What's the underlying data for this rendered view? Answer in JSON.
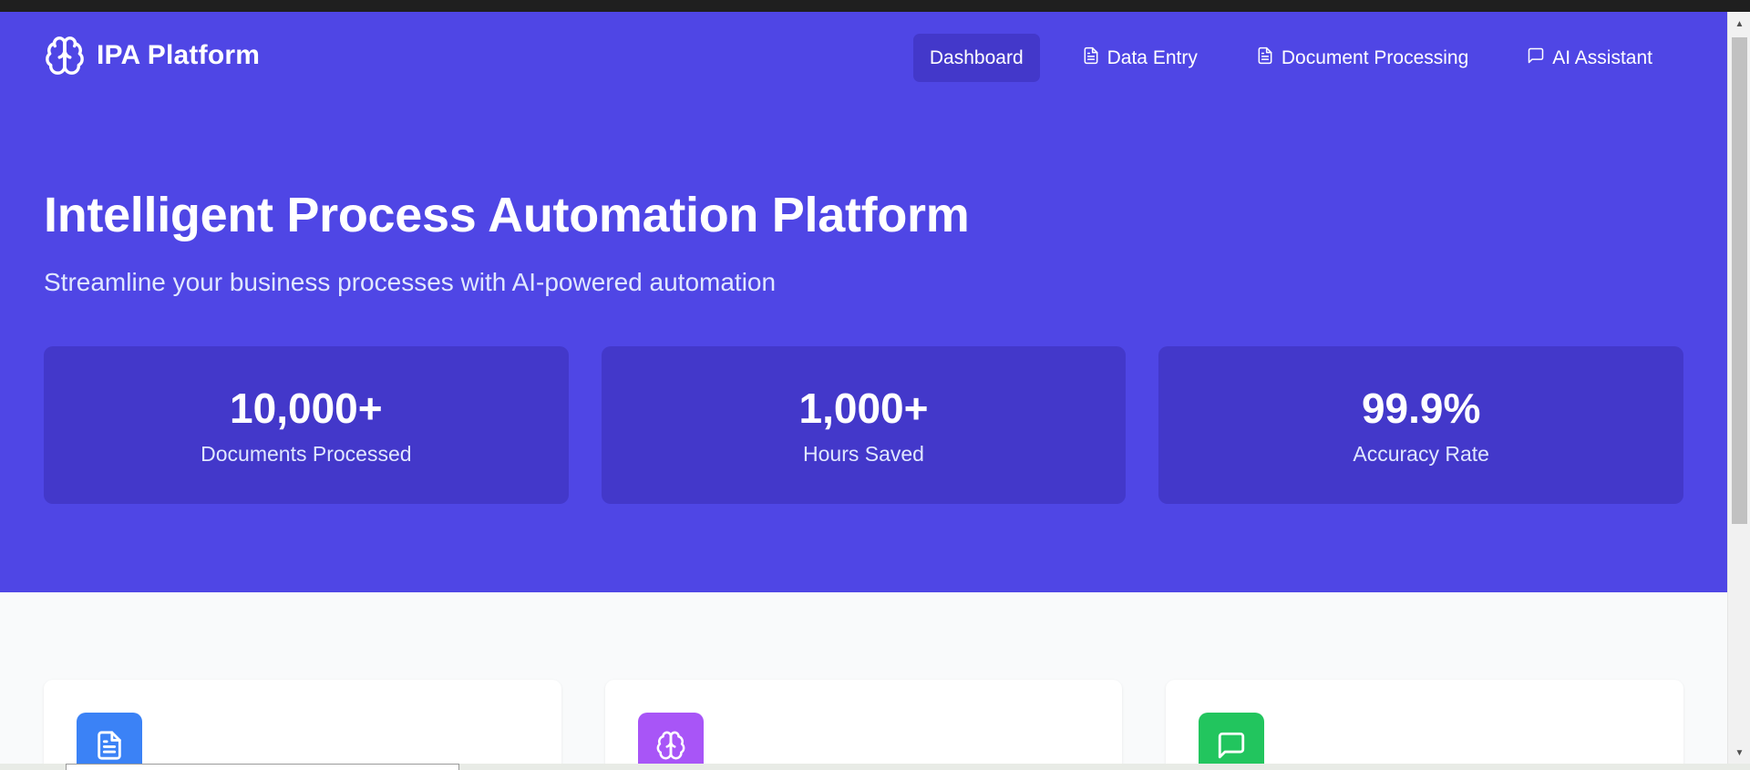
{
  "brand": {
    "name": "IPA Platform",
    "icon": "brain-icon"
  },
  "nav": {
    "items": [
      {
        "label": "Dashboard",
        "icon": "",
        "active": true
      },
      {
        "label": "Data Entry",
        "icon": "document-icon",
        "active": false
      },
      {
        "label": "Document Processing",
        "icon": "document-icon",
        "active": false
      },
      {
        "label": "AI Assistant",
        "icon": "chat-icon",
        "active": false
      }
    ]
  },
  "hero": {
    "title": "Intelligent Process Automation Platform",
    "subtitle": "Streamline your business processes with AI-powered automation"
  },
  "stats": [
    {
      "value": "10,000+",
      "label": "Documents Processed"
    },
    {
      "value": "1,000+",
      "label": "Hours Saved"
    },
    {
      "value": "99.9%",
      "label": "Accuracy Rate"
    }
  ],
  "features": [
    {
      "icon": "document-icon",
      "color": "#3b82f6"
    },
    {
      "icon": "brain-icon",
      "color": "#a855f7"
    },
    {
      "icon": "chat-icon",
      "color": "#22c55e"
    }
  ],
  "colors": {
    "primary": "#4f46e5",
    "primary_dark": "#4338ca",
    "page_bg": "#f9fafb"
  }
}
